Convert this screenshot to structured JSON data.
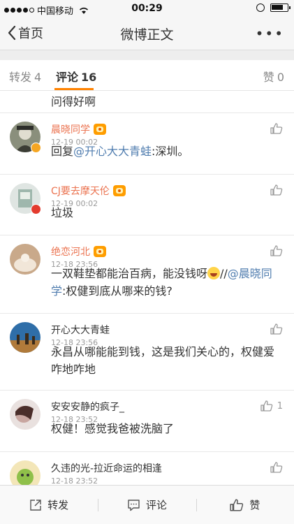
{
  "status_bar": {
    "carrier": "中国移动",
    "time": "00:29"
  },
  "nav": {
    "back_label": "首页",
    "title": "微博正文",
    "more_label": "•••"
  },
  "tabs": [
    {
      "label": "转发",
      "count": "4"
    },
    {
      "label": "评论",
      "count": "16"
    },
    {
      "label": "赞",
      "count": "0"
    }
  ],
  "comments_partial": {
    "text": "问得好啊"
  },
  "comments": [
    {
      "name": "晨晓同学",
      "time": "12-19 00:02",
      "body_parts": [
        "回复",
        "@开心大大青蛙",
        ":深圳。"
      ],
      "likes": ""
    },
    {
      "name": "CJ要去摩天伦",
      "time": "12-19 00:02",
      "body": "垃圾",
      "likes": ""
    },
    {
      "name": "绝恋河北",
      "time": "12-18 23:56",
      "body_parts": [
        "一双鞋垫都能治百病，能没钱呀",
        "//",
        "@晨晓同学",
        ":权健到底从哪来的钱?"
      ],
      "likes": ""
    },
    {
      "name": "开心大大青蛙",
      "time": "12-18 23:56",
      "body": "永昌从哪能能到钱，这是我们关心的，权健爱咋地咋地",
      "likes": ""
    },
    {
      "name": "安安安静的疯子_",
      "time": "12-18 23:52",
      "body": "权健！感觉我爸被洗脑了",
      "likes": "1"
    },
    {
      "name": "久违的光-拉近命运的相逢",
      "time": "12-18 23:52",
      "body": "",
      "likes": ""
    }
  ],
  "bottom_bar": {
    "repost_label": "转发",
    "comment_label": "评论",
    "like_label": "赞"
  },
  "colors": {
    "accent": "#ff8200",
    "name_orange": "#eb7350",
    "link_blue": "#507daf"
  }
}
